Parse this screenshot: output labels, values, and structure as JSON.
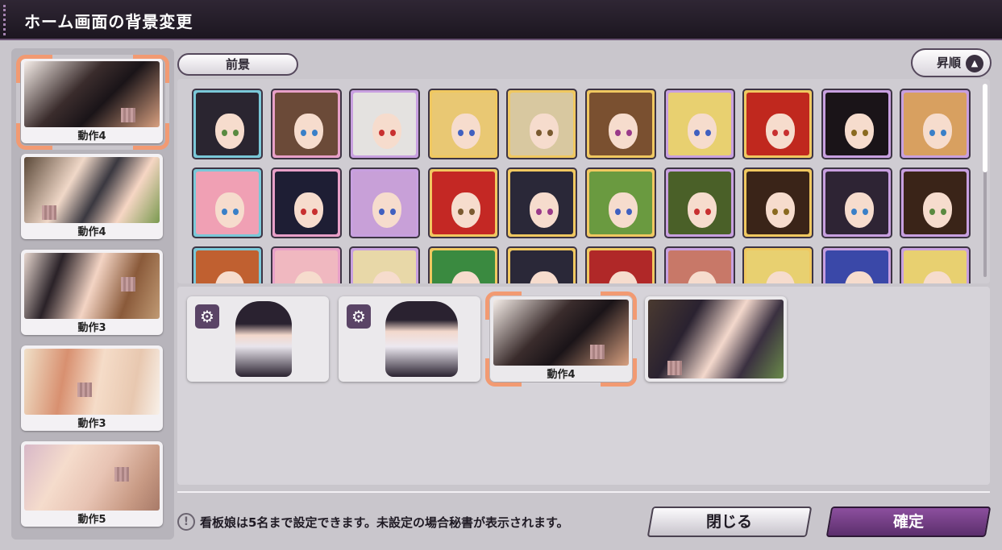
{
  "window": {
    "title": "ホーム画面の背景変更"
  },
  "left_panel": {
    "items": [
      {
        "label": "動作4",
        "selected": true
      },
      {
        "label": "動作4",
        "selected": false
      },
      {
        "label": "動作3",
        "selected": false
      },
      {
        "label": "動作3",
        "selected": false
      },
      {
        "label": "動作5",
        "selected": false
      }
    ]
  },
  "tabs": {
    "foreground_label": "前景"
  },
  "sort": {
    "label": "昇順",
    "arrow": "▲"
  },
  "grid": {
    "rows": 3,
    "portrait_colors": [
      [
        "#2a2530",
        "#6b4a38",
        "#e4e2e0",
        "#e9c873",
        "#d8c8a0",
        "#7a5030",
        "#e8d070",
        "#c0281e",
        "#1a1418",
        "#d8a060"
      ],
      [
        "#f0a0b4",
        "#1e1e34",
        "#c8a0d8",
        "#c42824",
        "#2a2838",
        "#6a9a40",
        "#4a6028",
        "#3a2418",
        "#2e2434",
        "#3a2418"
      ],
      [
        "#c06030",
        "#f0b8c0",
        "#e8d8a8",
        "#3a8a40",
        "#2a2838",
        "#b02828",
        "#c87868",
        "#e8d070",
        "#3a48a8",
        "#e8d070"
      ]
    ],
    "frame_colors": [
      "#7ac8d8",
      "#e8a0c8",
      "#c8a0e0",
      "#f0c860",
      "#f0c860",
      "#f0c860",
      "#c8a0e0",
      "#f0c860",
      "#c8a0e0",
      "#c8a0e0"
    ]
  },
  "slots": [
    {
      "type": "character",
      "has_gear": true,
      "label": ""
    },
    {
      "type": "character",
      "has_gear": true,
      "label": ""
    },
    {
      "type": "scene",
      "has_gear": false,
      "label": "動作4",
      "selected": true
    },
    {
      "type": "scene",
      "has_gear": false,
      "label": ""
    }
  ],
  "footer": {
    "notice_icon": "!",
    "notice_text": "看板娘は5名まで設定できます。未設定の場合秘書が表示されます。",
    "close_label": "閉じる",
    "confirm_label": "確定"
  },
  "colors": {
    "accent": "#f29a72",
    "confirm_button": "#6e3a80",
    "title_bar": "#241c29"
  }
}
